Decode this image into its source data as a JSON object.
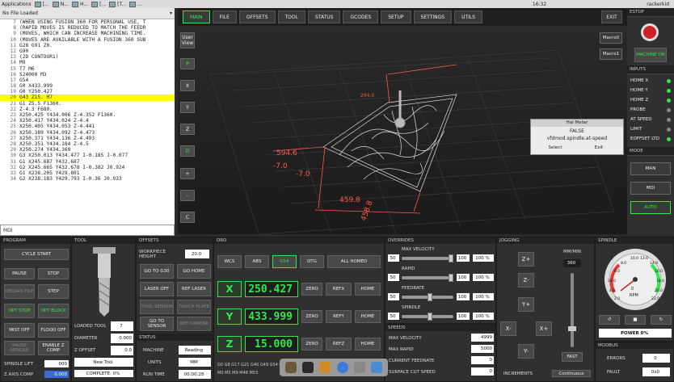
{
  "taskbar": {
    "apps": "Applications",
    "items": [
      "[...",
      "N...",
      "H...",
      "[...",
      "[T...",
      "..."
    ],
    "time": "16:32",
    "user": "rackerkid"
  },
  "file_header": {
    "title": "No File Loaded"
  },
  "gcode": [
    {
      "n": "7",
      "t": "(WHEN USING FUSION 360 FOR PERSONAL USE, T"
    },
    {
      "n": "8",
      "t": "(RAPID MOVES IS REDUCED TO MATCH THE FEEDR"
    },
    {
      "n": "9",
      "t": "(MOVES, WHICH CAN INCREASE MACHINING TIME."
    },
    {
      "n": "10",
      "t": "(MOVES ARE AVAILABLE WITH A FUSION 360 SUB"
    },
    {
      "n": "11",
      "t": "G28 G91 Z0."
    },
    {
      "n": "12",
      "t": "G90"
    },
    {
      "n": "13",
      "t": "(2D CONTOUR1)"
    },
    {
      "n": "14",
      "t": "M9"
    },
    {
      "n": "15",
      "t": "T7 M6"
    },
    {
      "n": "16",
      "t": "S24000 M3"
    },
    {
      "n": "17",
      "t": "G54"
    },
    {
      "n": "18",
      "t": "G0 X433.999"
    },
    {
      "n": "19",
      "t": "G0 Y250.427"
    },
    {
      "n": "20",
      "t": "G43 Z15. H7",
      "hl": true
    },
    {
      "n": "21",
      "t": "G1 Z5.5 F1360."
    },
    {
      "n": "22",
      "t": "Z-4.3 F680."
    },
    {
      "n": "23",
      "t": "X250.425 Y434.006 Z-4.352 F1360."
    },
    {
      "n": "24",
      "t": "X250.417 Y434.024 Z-4.4"
    },
    {
      "n": "25",
      "t": "X250.405 Y434.053 Z-4.441"
    },
    {
      "n": "26",
      "t": "X250.389 Y434.092 Z-4.473"
    },
    {
      "n": "27",
      "t": "X250.371 Y434.136 Z-4.493"
    },
    {
      "n": "28",
      "t": "X250.351 Y434.184 Z-4.5"
    },
    {
      "n": "29",
      "t": "X250.274 Y434.369"
    },
    {
      "n": "30",
      "t": "G3 X250.013 Y434.477 I-0.185 J-0.077"
    },
    {
      "n": "31",
      "t": "G1 X245.687 Y432.687"
    },
    {
      "n": "32",
      "t": "G2 X245.665 Y432.678 I-0.382 J0.924"
    },
    {
      "n": "33",
      "t": "G1 X238.205 Y429.801"
    },
    {
      "n": "34",
      "t": "G2 X238.183 Y429.793 I-0.36 J0.933"
    }
  ],
  "mdi": {
    "placeholder": "MDI"
  },
  "tabs": [
    "MAIN",
    "FILE",
    "OFFSETS",
    "TOOL",
    "STATUS",
    "GCODES",
    "SETUP",
    "SETTINGS",
    "UTILS"
  ],
  "exit_label": "EXIT",
  "view_buttons": [
    "User View",
    "P",
    "X",
    "Y",
    "Z",
    "D",
    "+",
    "-",
    "C"
  ],
  "macros": [
    "Macro0",
    "Macro1"
  ],
  "dims": {
    "a": "594.6",
    "b": "-7.0",
    "c": "459.8",
    "d": "458.8",
    "e": "264.0",
    "f": "-7.0"
  },
  "hal_meter": {
    "title": "Hal Meter",
    "value": "FALSE",
    "pin": "vfdmod.spindle.at-speed",
    "select": "Select",
    "exit": "Exit"
  },
  "estop": {
    "title": "ESTOP",
    "machine_on": "MACHINE ON"
  },
  "inputs": {
    "title": "INPUTS",
    "items": [
      "HOME X",
      "HOME Y",
      "HOME Z",
      "PROBE",
      "AT SPEED",
      "LIMIT",
      "EOFFSET LTD"
    ],
    "states": [
      true,
      true,
      true,
      false,
      false,
      false,
      true
    ]
  },
  "mode": {
    "title": "MODE",
    "buttons": [
      "MAN",
      "MDI",
      "AUTO"
    ]
  },
  "program": {
    "title": "PROGRAM",
    "cycle_start": "CYCLE START",
    "pause": "PAUSE",
    "stop": "STOP",
    "reload": "RELOAD FILE",
    "step": "STEP",
    "opt_stop": "OPT STOP",
    "opt_block": "OPT BLOCK",
    "mist": "MIST OFF",
    "flood": "FLOOD OFF",
    "pause_spindle": "PAUSE SPINDLE",
    "enable_z": "ENABLE Z COMP",
    "spindle_lift_label": "SPINDLE LIFT",
    "spindle_lift": "000",
    "z_axis_comp_label": "Z AXIS COMP",
    "z_axis_comp": "0.000"
  },
  "tool": {
    "title": "TOOL",
    "loaded_label": "LOADED TOOL",
    "loaded": "7",
    "diameter_label": "DIAMETER",
    "diameter": "0.000",
    "zoffset_label": "Z OFFSET",
    "zoffset": "0.0",
    "new_tool": "New Tool",
    "complete": "COMPLETE: 0%"
  },
  "offsets": {
    "title": "OFFSETS",
    "workpiece_label": "WORKPIECE HEIGHT",
    "workpiece": "20.0",
    "goto_g30": "GO TO G30",
    "go_home": "GO HOME",
    "laser_off": "LASER OFF",
    "ref_laser": "REF LASER",
    "tool_sensor": "TOOL SENSOR",
    "touch_plate": "TOUCH PLATE",
    "goto_sensor": "GO TO SENSOR",
    "ref_camera": "REF CAMERA"
  },
  "status": {
    "title": "STATUS",
    "machine_label": "MACHINE",
    "machine": "Reading",
    "units_label": "UNITS",
    "units": "MM",
    "runtime_label": "RUN TIME",
    "runtime": "00:00:28"
  },
  "dro": {
    "title": "DRO",
    "wcs": "WCS",
    "abs": "ABS",
    "g54": "G54",
    "dtg": "DTG",
    "all_homed": "ALL HOMED",
    "x": "250.427",
    "y": "433.999",
    "z": "15.000",
    "zero": "ZERO",
    "refx": "REFX",
    "refy": "REFY",
    "refz": "REFZ",
    "home": "HOME",
    "gcodes": "G0 G8 G17 G21 G40 G49 G54 G64 G...",
    "mcodes": "M0 M5 M9 M48 M53"
  },
  "overrides": {
    "title": "OVERRIDES",
    "max_velocity": "MAX VELOCITY",
    "rapid": "RAPID",
    "feedrate": "FEEDRATE",
    "spindle": "SPINDLE",
    "lo": "50",
    "hi": "100",
    "pct": "100 %"
  },
  "speeds": {
    "title": "SPEEDS",
    "max_velocity_label": "MAX VELOCITY",
    "max_velocity": "4999",
    "max_rapid_label": "MAX RAPID",
    "max_rapid": "5000",
    "current_feed_label": "CURRENT FEEDRATE",
    "current_feed": "0",
    "surface_label": "SURFACE CUT SPEED",
    "surface": "0"
  },
  "jogging": {
    "title": "JOGGING",
    "unit": "MM/MIN",
    "rate": "360",
    "fast": "FAST",
    "increments_label": "INCREMENTS",
    "increments": "Continuous",
    "z_plus": "Z+",
    "z_minus": "Z-",
    "y_plus": "Y+",
    "y_minus": "Y-",
    "x_plus": "X+",
    "x_minus": "X-"
  },
  "spindle": {
    "title": "SPINDLE",
    "rpm": "0",
    "rpm_label": "RPM",
    "power": "POWER 0%",
    "gauge_labels": [
      "6.0",
      "8.0",
      "10.0",
      "12.0",
      "14.0",
      "16.0",
      "18.0",
      "20.0",
      "22.0",
      "24.0",
      "4.0",
      "2.0",
      "0.0"
    ]
  },
  "modbus": {
    "title": "MODBUS",
    "errors_label": "ERRORS",
    "errors": "0",
    "fault_label": "FAULT",
    "fault": "0x0"
  },
  "colors": {
    "accent": "#2ee94a",
    "estop": "#e23b2e"
  }
}
